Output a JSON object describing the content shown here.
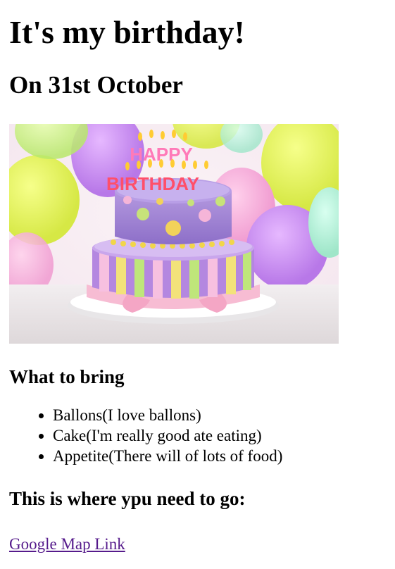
{
  "page": {
    "title": "It's my birthday!",
    "date_heading": "On 31st October",
    "image": {
      "icon": "birthday-cake-photo",
      "candle_text_top": "HAPPY",
      "candle_text_bottom": "BIRTHDAY"
    },
    "bring_heading": "What to bring",
    "bring_items": [
      "Ballons(I love ballons)",
      "Cake(I'm really good ate eating)",
      "Appetite(There will of lots of food)"
    ],
    "where_heading": "This is where ypu need to go:",
    "map_link_text": "Google Map Link"
  },
  "colors": {
    "link": "#551a8b",
    "text": "#000000",
    "background": "#ffffff"
  }
}
